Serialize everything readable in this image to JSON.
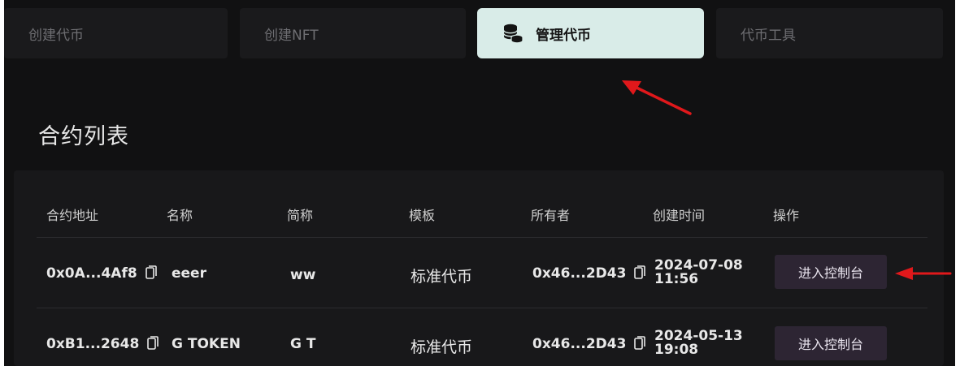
{
  "tabs": [
    {
      "label": "创建代币",
      "active": false
    },
    {
      "label": "创建NFT",
      "active": false
    },
    {
      "label": "管理代币",
      "active": true,
      "icon": "coin-stack-icon"
    },
    {
      "label": "代币工具",
      "active": false
    }
  ],
  "page_title": "合约列表",
  "table": {
    "columns": [
      "合约地址",
      "名称",
      "简称",
      "模板",
      "所有者",
      "创建时间",
      "操作"
    ],
    "rows": [
      {
        "address": "0x0A...4Af8",
        "name": "eeer",
        "symbol": "ww",
        "template": "标准代币",
        "owner": "0x46...2D43",
        "created_date": "2024-07-08",
        "created_time": "11:56",
        "action": "进入控制台"
      },
      {
        "address": "0xB1...2648",
        "name": "G TOKEN",
        "symbol": "G T",
        "template": "标准代币",
        "owner": "0x46...2D43",
        "created_date": "2024-05-13",
        "created_time": "19:08",
        "action": "进入控制台"
      }
    ]
  },
  "colors": {
    "background": "#111112",
    "active_tab": "#d9ece8",
    "annotation_arrow": "#e0181b",
    "button": "#2d2533"
  }
}
